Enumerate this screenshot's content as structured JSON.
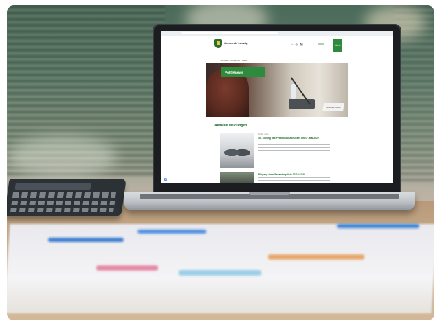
{
  "website": {
    "site_name": "Gemeinde Ludwig",
    "header_icons": "⌂ ◷ 🗺",
    "search_label": "Suche",
    "menu_label": "Menü",
    "breadcrumb": "Startseite  ›  Bürgerinfo  ›  Politik",
    "hero_banner": "Politik/news",
    "nameplate": "Gemeinde Ludwig",
    "section_title": "Aktuelle Meldungen",
    "news": [
      {
        "meta": "Politik · News",
        "title": "35. Sitzung des Petitionsausschusses am 17. Mai 2022"
      },
      {
        "meta": "",
        "title": "Eingang einer Bauantragsliste 07/01/4218"
      }
    ]
  }
}
